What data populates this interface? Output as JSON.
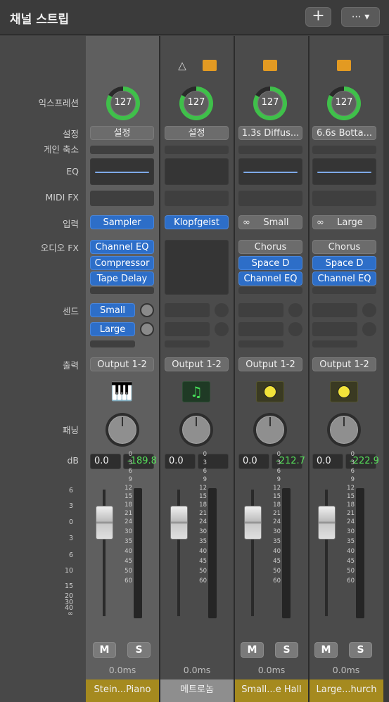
{
  "title": "채널 스트립",
  "toolbar": {
    "add_label": "+",
    "more_label": "⋯ ▾"
  },
  "labels": {
    "expression": "익스프레션",
    "setting": "설정",
    "gain_reduction": "게인 축소",
    "eq": "EQ",
    "midi_fx": "MIDI FX",
    "input": "입력",
    "audio_fx": "오디오 FX",
    "sends": "센드",
    "output": "출력",
    "pan": "패닝",
    "db": "dB"
  },
  "colors": {
    "selected_strip": "#5f5f5f",
    "blue_slot": "#2d6ec8",
    "green_value": "#56e05a",
    "name_bar_yellow": "#a58a1f",
    "name_bar_gray": "#8e8e8e"
  },
  "strips": [
    {
      "expression": "127",
      "setting": "설정",
      "input": "Sampler",
      "audio_fx": [
        "Channel EQ",
        "Compressor",
        "Tape Delay"
      ],
      "sends": [
        "Small",
        "Large"
      ],
      "output": "Output 1-2",
      "volume": "0.0",
      "peak": "-189.8",
      "mute": "M",
      "solo": "S",
      "latency": "0.0ms",
      "name": "Stein...Piano",
      "icon": "grand-piano-icon"
    },
    {
      "expression": "127",
      "setting": "설정",
      "input": "Klopfgeist",
      "audio_fx": [],
      "sends": [],
      "output": "Output 1-2",
      "volume": "0.0",
      "peak": "",
      "mute": "M",
      "solo": "S",
      "latency": "0.0ms",
      "name": "메트로놈",
      "icon": "music-note-icon"
    },
    {
      "expression": "127",
      "setting": "1.3s Diffus...",
      "input": "Small",
      "audio_fx": [
        "Chorus",
        "Space D",
        "Channel EQ"
      ],
      "sends": [],
      "output": "Output 1-2",
      "volume": "0.0",
      "peak": "-212.7",
      "mute": "M",
      "solo": "S",
      "latency": "0.0ms",
      "name": "Small...e Hall",
      "icon": "aux-meter-icon"
    },
    {
      "expression": "127",
      "setting": "6.6s Botta...",
      "input": "Large",
      "audio_fx": [
        "Chorus",
        "Space D",
        "Channel EQ"
      ],
      "sends": [],
      "output": "Output 1-2",
      "volume": "0.0",
      "peak": "-222.9",
      "mute": "M",
      "solo": "S",
      "latency": "0.0ms",
      "name": "Large...hurch",
      "icon": "aux-meter-icon"
    }
  ],
  "fader_scale": [
    "6",
    "3",
    "0",
    "3",
    "6",
    "10",
    "15",
    "20",
    "30",
    "40",
    "∞"
  ],
  "meter_scale": [
    "0",
    "3",
    "6",
    "9",
    "12",
    "15",
    "18",
    "21",
    "24",
    "30",
    "35",
    "40",
    "45",
    "50",
    "60"
  ]
}
